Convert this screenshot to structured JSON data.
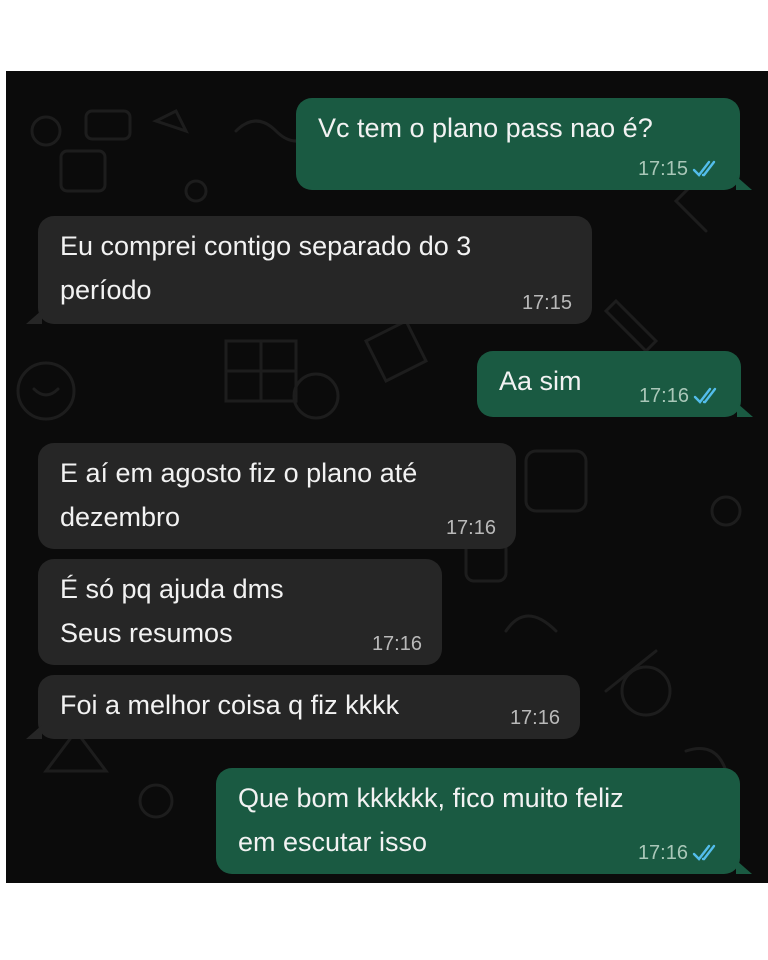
{
  "colors": {
    "background": "#0b0b0b",
    "incoming_bubble": "#262626",
    "outgoing_bubble": "#1a5a42",
    "read_ticks": "#53bdeb"
  },
  "messages": [
    {
      "direction": "out",
      "text": "Vc tem o plano pass nao é?",
      "time": "17:15",
      "status": "read"
    },
    {
      "direction": "in",
      "text": "Eu comprei contigo separado do 3\nperíodo",
      "time": "17:15"
    },
    {
      "direction": "out",
      "text": "Aa sim",
      "time": "17:16",
      "status": "read"
    },
    {
      "direction": "in",
      "text": "E aí em agosto fiz o plano até\ndezembro",
      "time": "17:16"
    },
    {
      "direction": "in",
      "text": "É só pq ajuda dms\nSeus resumos",
      "time": "17:16"
    },
    {
      "direction": "in",
      "text": "Foi a melhor coisa q fiz kkkk",
      "time": "17:16"
    },
    {
      "direction": "out",
      "text": "Que bom kkkkkk, fico muito feliz\nem escutar isso",
      "time": "17:16",
      "status": "read"
    }
  ]
}
